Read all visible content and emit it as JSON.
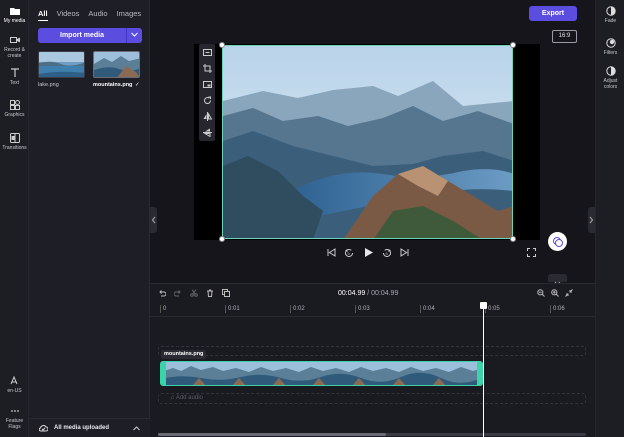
{
  "left_rail": {
    "items": [
      {
        "label": "My media",
        "icon": "folder-icon"
      },
      {
        "label": "Record &\ncreate",
        "icon": "camera-icon"
      },
      {
        "label": "Text",
        "icon": "text-icon"
      },
      {
        "label": "Graphics",
        "icon": "shapes-icon"
      },
      {
        "label": "Transitions",
        "icon": "transitions-icon"
      }
    ],
    "bottom": [
      {
        "label": "en-US",
        "icon": "language-icon"
      },
      {
        "label": "Feature\nFlags",
        "icon": "more-icon"
      }
    ]
  },
  "media_panel": {
    "tabs": [
      "All",
      "Videos",
      "Audio",
      "Images"
    ],
    "import_label": "Import media",
    "items": [
      {
        "name": "lake.png"
      },
      {
        "name": "mountains.png",
        "check": "✓"
      }
    ],
    "footer": "All media uploaded"
  },
  "header": {
    "export_label": "Export",
    "aspect_ratio": "16:9"
  },
  "right_rail": {
    "items": [
      {
        "label": "Fade",
        "icon": "fade-icon"
      },
      {
        "label": "Filters",
        "icon": "filters-icon"
      },
      {
        "label": "Adjust\ncolors",
        "icon": "adjust-colors-icon"
      }
    ]
  },
  "timeline": {
    "current_time": "00:04.99",
    "total_time": "00:04.99",
    "ruler": [
      "0",
      "0:01",
      "0:02",
      "0:03",
      "0:04",
      "0:05",
      "0:06"
    ],
    "clip_label": "mountains.png",
    "add_audio_label": "Add audio"
  },
  "colors": {
    "accent": "#5b4de0",
    "selection": "#3bd3a8"
  }
}
